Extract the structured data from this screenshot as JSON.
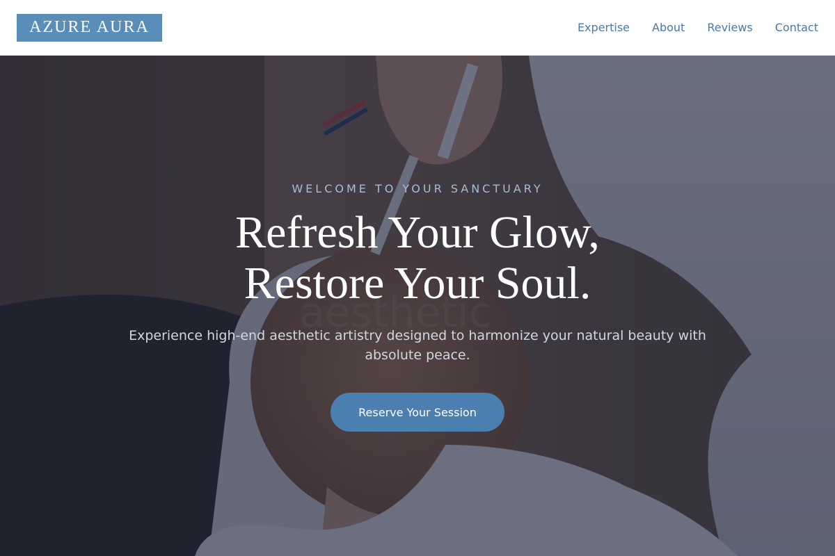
{
  "brand": {
    "name": "AZURE AURA",
    "color": "#5b8db9"
  },
  "nav": {
    "items": [
      {
        "label": "Expertise"
      },
      {
        "label": "About"
      },
      {
        "label": "Reviews"
      },
      {
        "label": "Contact"
      }
    ]
  },
  "hero": {
    "eyebrow": "WELCOME TO YOUR SANCTUARY",
    "headline_line1": "Refresh Your Glow,",
    "headline_line2": "Restore Your Soul.",
    "subtext": "Experience high-end aesthetic artistry designed to harmonize your natural beauty with absolute peace.",
    "cta_label": "Reserve Your Session",
    "cta_color": "#4a7fb0",
    "background_image": "facial-treatment-photo"
  }
}
